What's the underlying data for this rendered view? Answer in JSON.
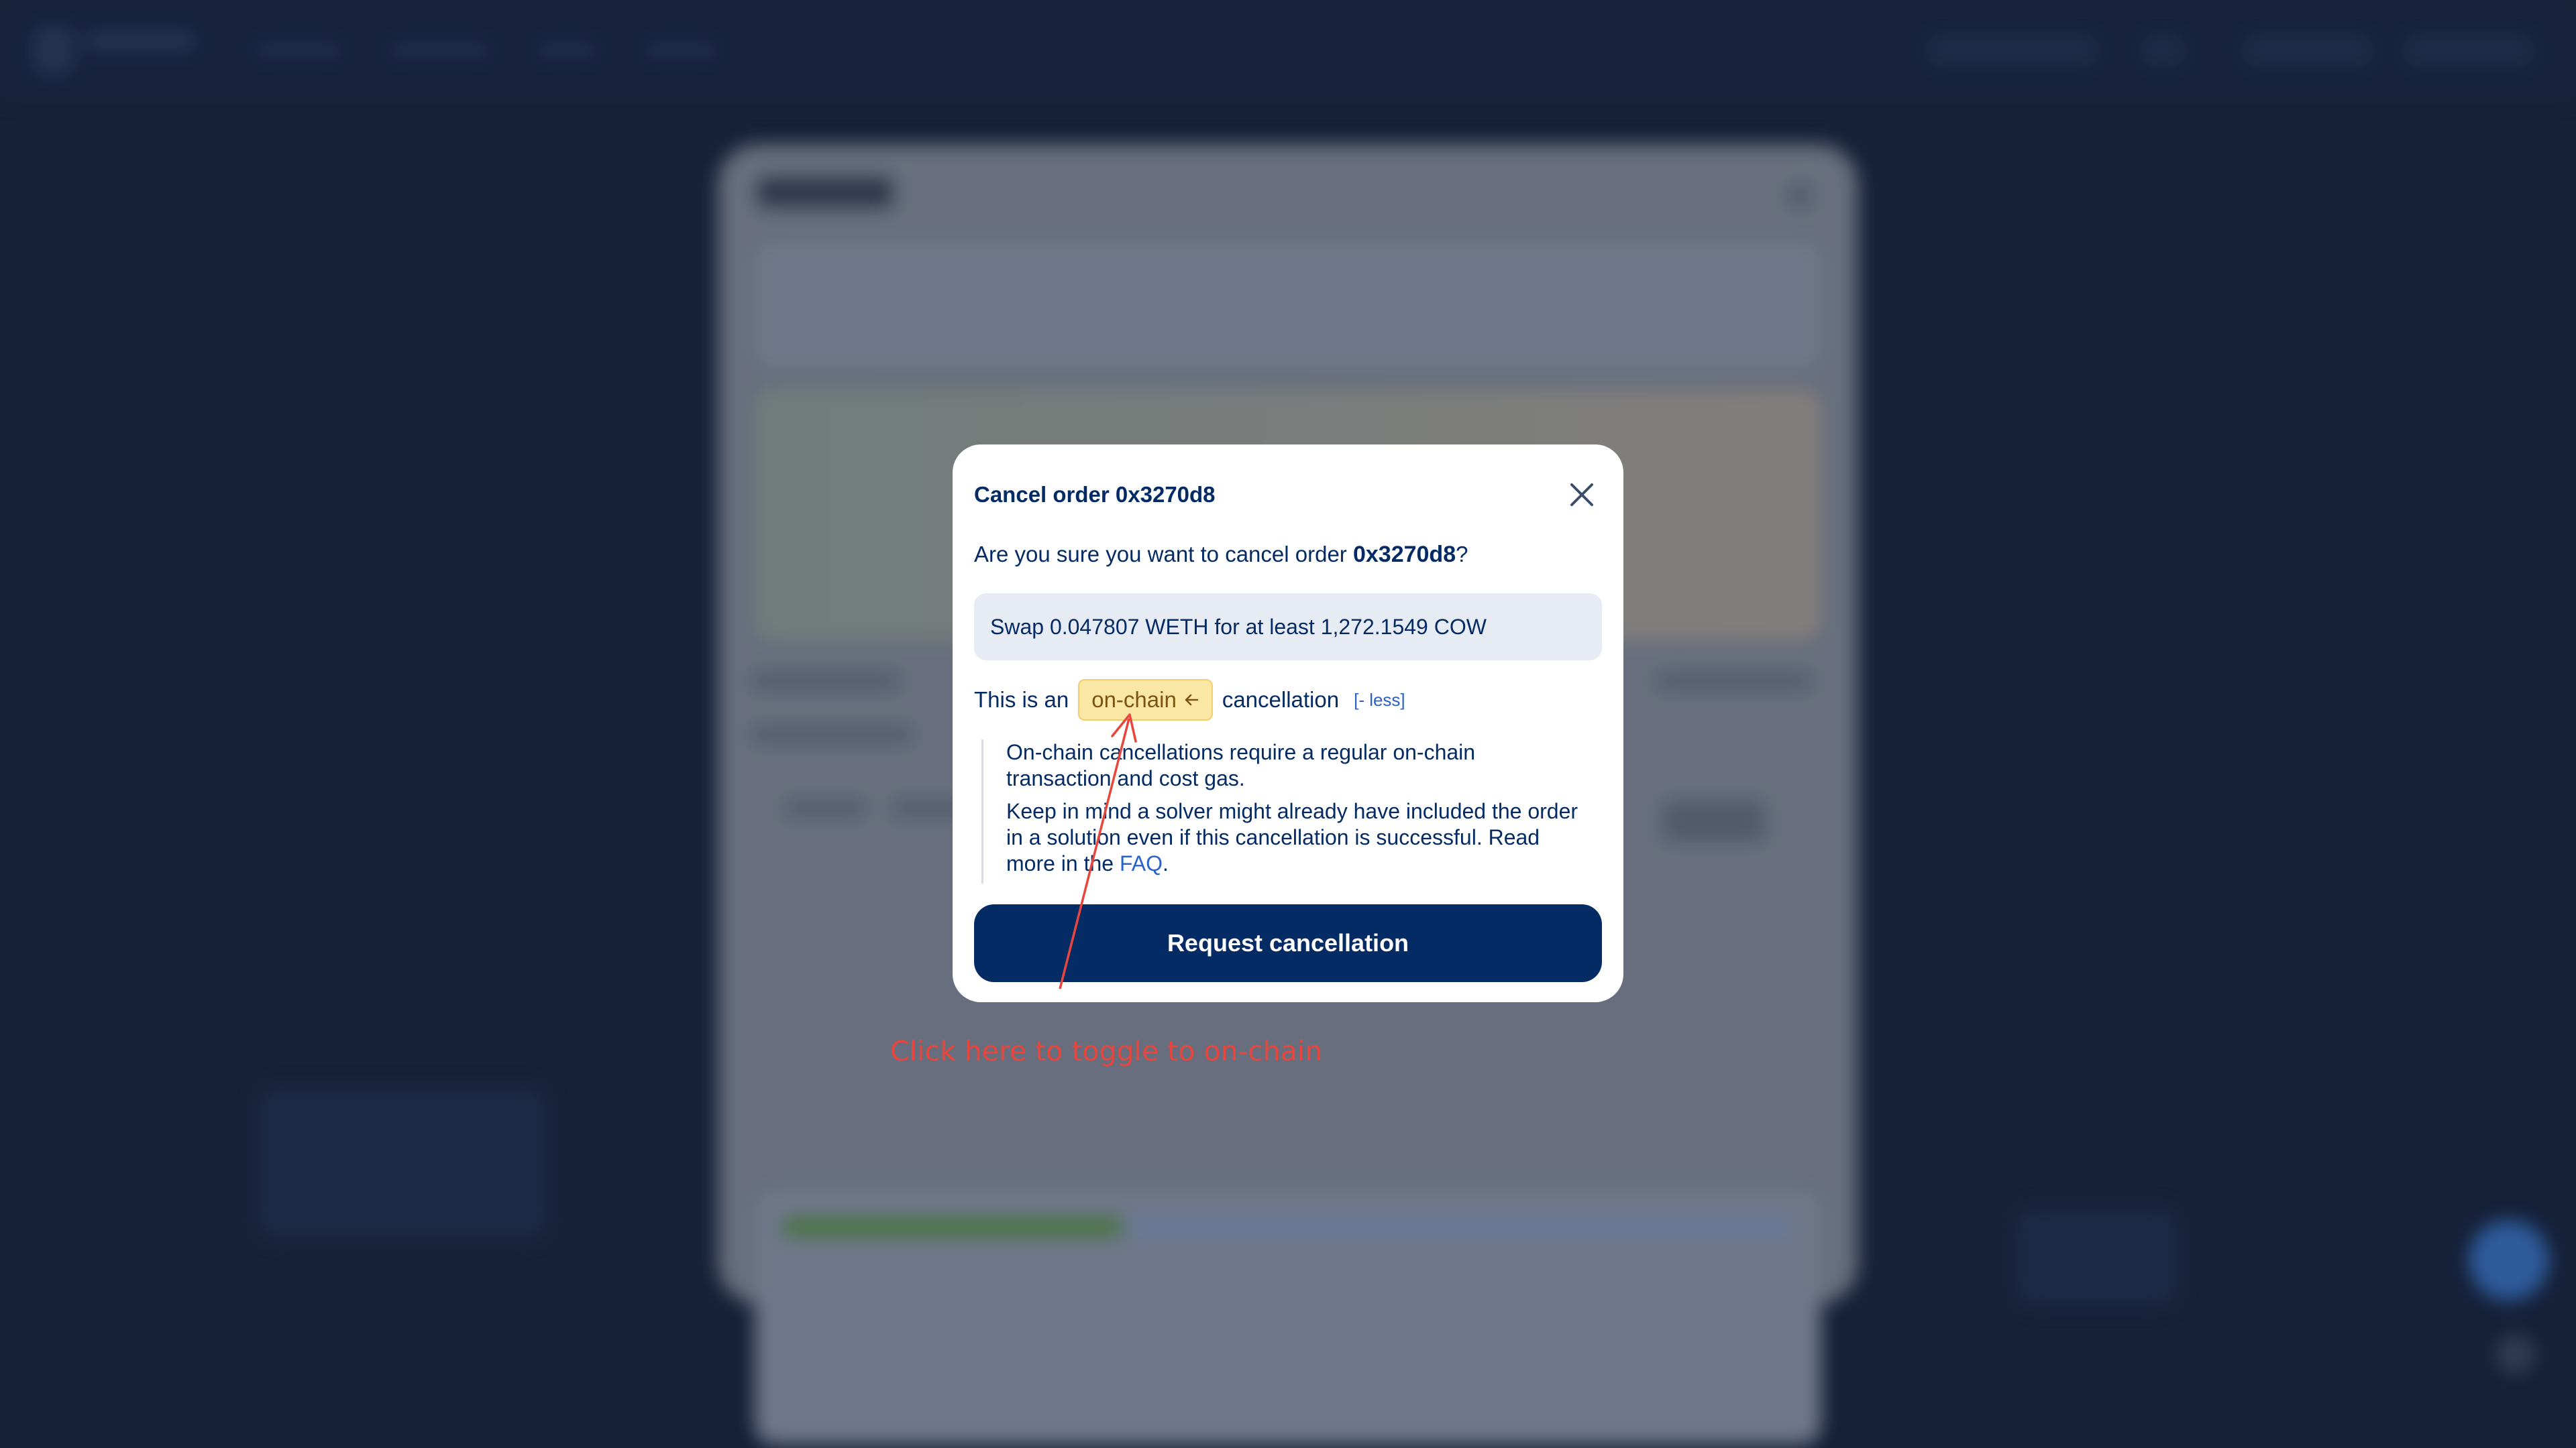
{
  "modal": {
    "title": "Cancel order 0x3270d8",
    "question_prefix": "Are you sure you want to cancel order ",
    "order_id": "0x3270d8",
    "question_suffix": "?",
    "summary": "Swap 0.047807 WETH for at least 1,272.1549 COW",
    "type_prefix": "This is an",
    "type_chip_label": "on-chain",
    "type_suffix": "cancellation",
    "less_link": "[- less]",
    "explain_p1": "On-chain cancellations require a regular on-chain transaction and cost gas.",
    "explain_p2_before": "Keep in mind a solver might already have included the order in a solution even if this cancellation is successful. Read more in the ",
    "faq_link": "FAQ",
    "explain_p2_after": ".",
    "primary_button": "Request cancellation"
  },
  "annotation": {
    "text": "Click here to toggle to on-chain",
    "color": "#e8453c"
  },
  "colors": {
    "brand_navy": "#052b65",
    "chip_bg": "#fbe7a5",
    "link_blue": "#2a62c9",
    "page_bg": "#16223a"
  },
  "icons": {
    "close": "close-icon",
    "chip_arrow": "arrow-left-icon"
  }
}
